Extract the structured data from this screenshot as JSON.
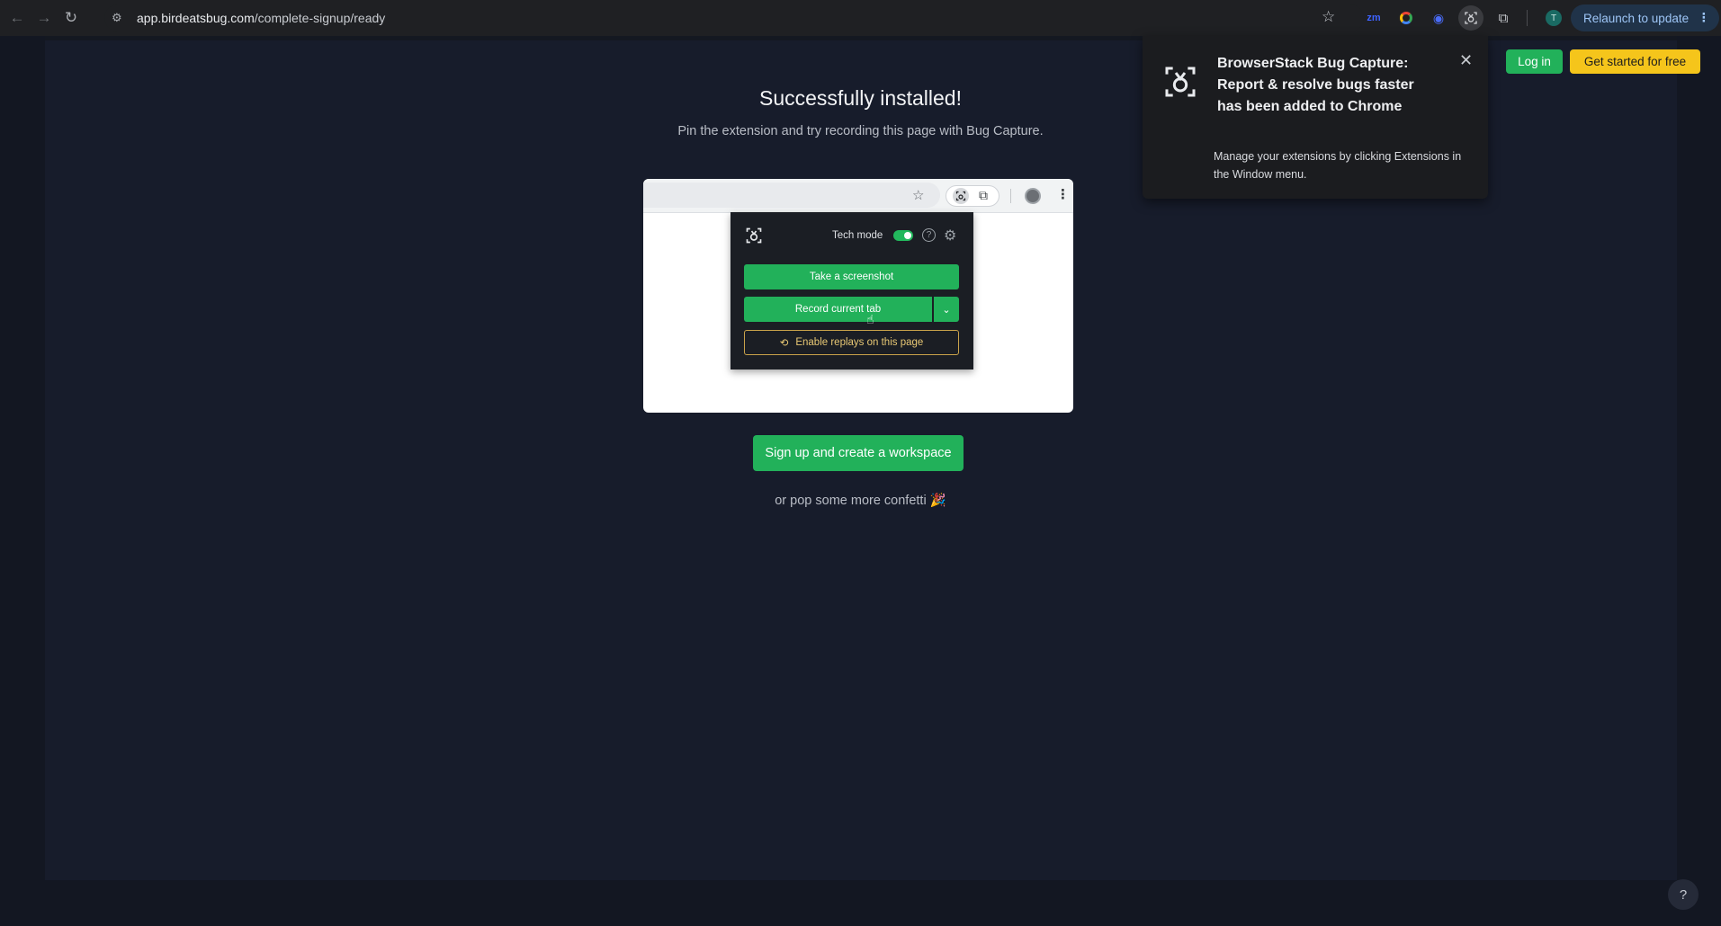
{
  "browser": {
    "url_host": "app.birdeatsbug.com",
    "url_path": "/complete-signup/ready",
    "relaunch_label": "Relaunch to update",
    "profile_initial": "T",
    "extensions": [
      {
        "name": "zoom",
        "glyph": "zm"
      },
      {
        "name": "google-colors",
        "glyph": ""
      },
      {
        "name": "blue-extension",
        "glyph": "◉"
      },
      {
        "name": "bug-capture",
        "glyph": "Ꭷ"
      }
    ]
  },
  "page": {
    "title": "Successfully installed!",
    "subtitle": "Pin the extension and try recording this page with Bug Capture.",
    "header": {
      "login_label": "Log in",
      "get_started_label": "Get started for free"
    },
    "preview": {
      "tech_mode_label": "Tech mode",
      "tech_mode_on": true,
      "take_screenshot_label": "Take a screenshot",
      "record_tab_label": "Record current tab",
      "enable_replays_label": "Enable replays on this page"
    },
    "cta_label": "Sign up and create a workspace",
    "confetti_label": "or pop some more confetti 🎉",
    "help_label": "?"
  },
  "extension_bubble": {
    "title": "BrowserStack Bug Capture: Report & resolve bugs faster has been added to Chrome",
    "body": "Manage your extensions by clicking Extensions in the Window menu."
  },
  "colors": {
    "accent_green": "#22b15a",
    "accent_yellow": "#f5c51b",
    "page_bg": "#171c2b"
  }
}
